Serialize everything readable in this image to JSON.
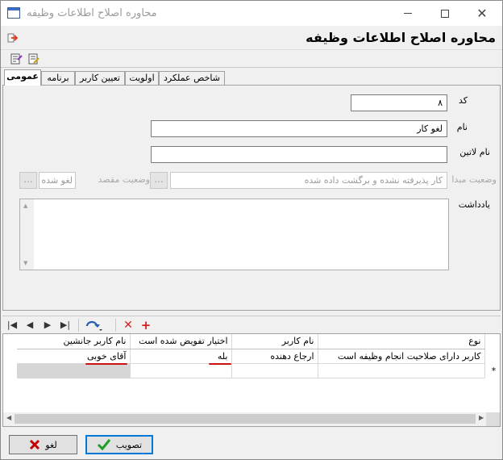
{
  "window": {
    "title": "محاوره اصلاح اطلاعات وظیفه",
    "minimize_icon": "minimize-icon",
    "maximize_icon": "maximize-icon",
    "close_icon": "close-icon"
  },
  "header": {
    "form_title": "محاوره اصلاح اطلاعات وظیفه",
    "exit_icon": "exit-icon"
  },
  "toolbar": {
    "icons": [
      "properties-icon",
      "edit-form-icon"
    ]
  },
  "tabs": [
    {
      "label": "عمومی",
      "active": true
    },
    {
      "label": "برنامه",
      "active": false
    },
    {
      "label": "تعیین کاربر",
      "active": false
    },
    {
      "label": "اولویت",
      "active": false
    },
    {
      "label": "شاخص عملکرد",
      "active": false
    }
  ],
  "form": {
    "code_label": "کد",
    "code_value": "۸",
    "name_label": "نام",
    "name_value": "لغو کار",
    "latin_name_label": "نام لاتین",
    "latin_name_value": "",
    "source_status_label": "وضعیت مبدا",
    "source_status_value": "کار پذیرفته نشده و برگشت داده شده",
    "dest_status_label": "وضعیت مقصد",
    "dest_status_value": "لغو شده",
    "ellipsis": "...",
    "note_label": "یادداشت",
    "note_value": ""
  },
  "grid_toolbar": {
    "icons": [
      "first-record-icon",
      "prev-record-icon",
      "next-record-icon",
      "last-record-icon",
      "refresh-icon",
      "delete-icon",
      "add-icon"
    ]
  },
  "grid": {
    "columns": [
      "نوع",
      "نام کاربر",
      "اختیار تفویض شده است",
      "نام کاربر جانشین"
    ],
    "rows": [
      [
        "کاربر دارای صلاحیت انجام وظیفه است",
        "ارجاع دهنده",
        "بله",
        "آقای خوبی"
      ]
    ],
    "new_row_marker": "*"
  },
  "buttons": {
    "ok_label": "تصویب",
    "cancel_label": "لغو"
  },
  "colors": {
    "accent": "#0078d7",
    "underline": "#cc1111",
    "ok_check": "#1f9d2a",
    "cancel_x": "#c00000"
  }
}
